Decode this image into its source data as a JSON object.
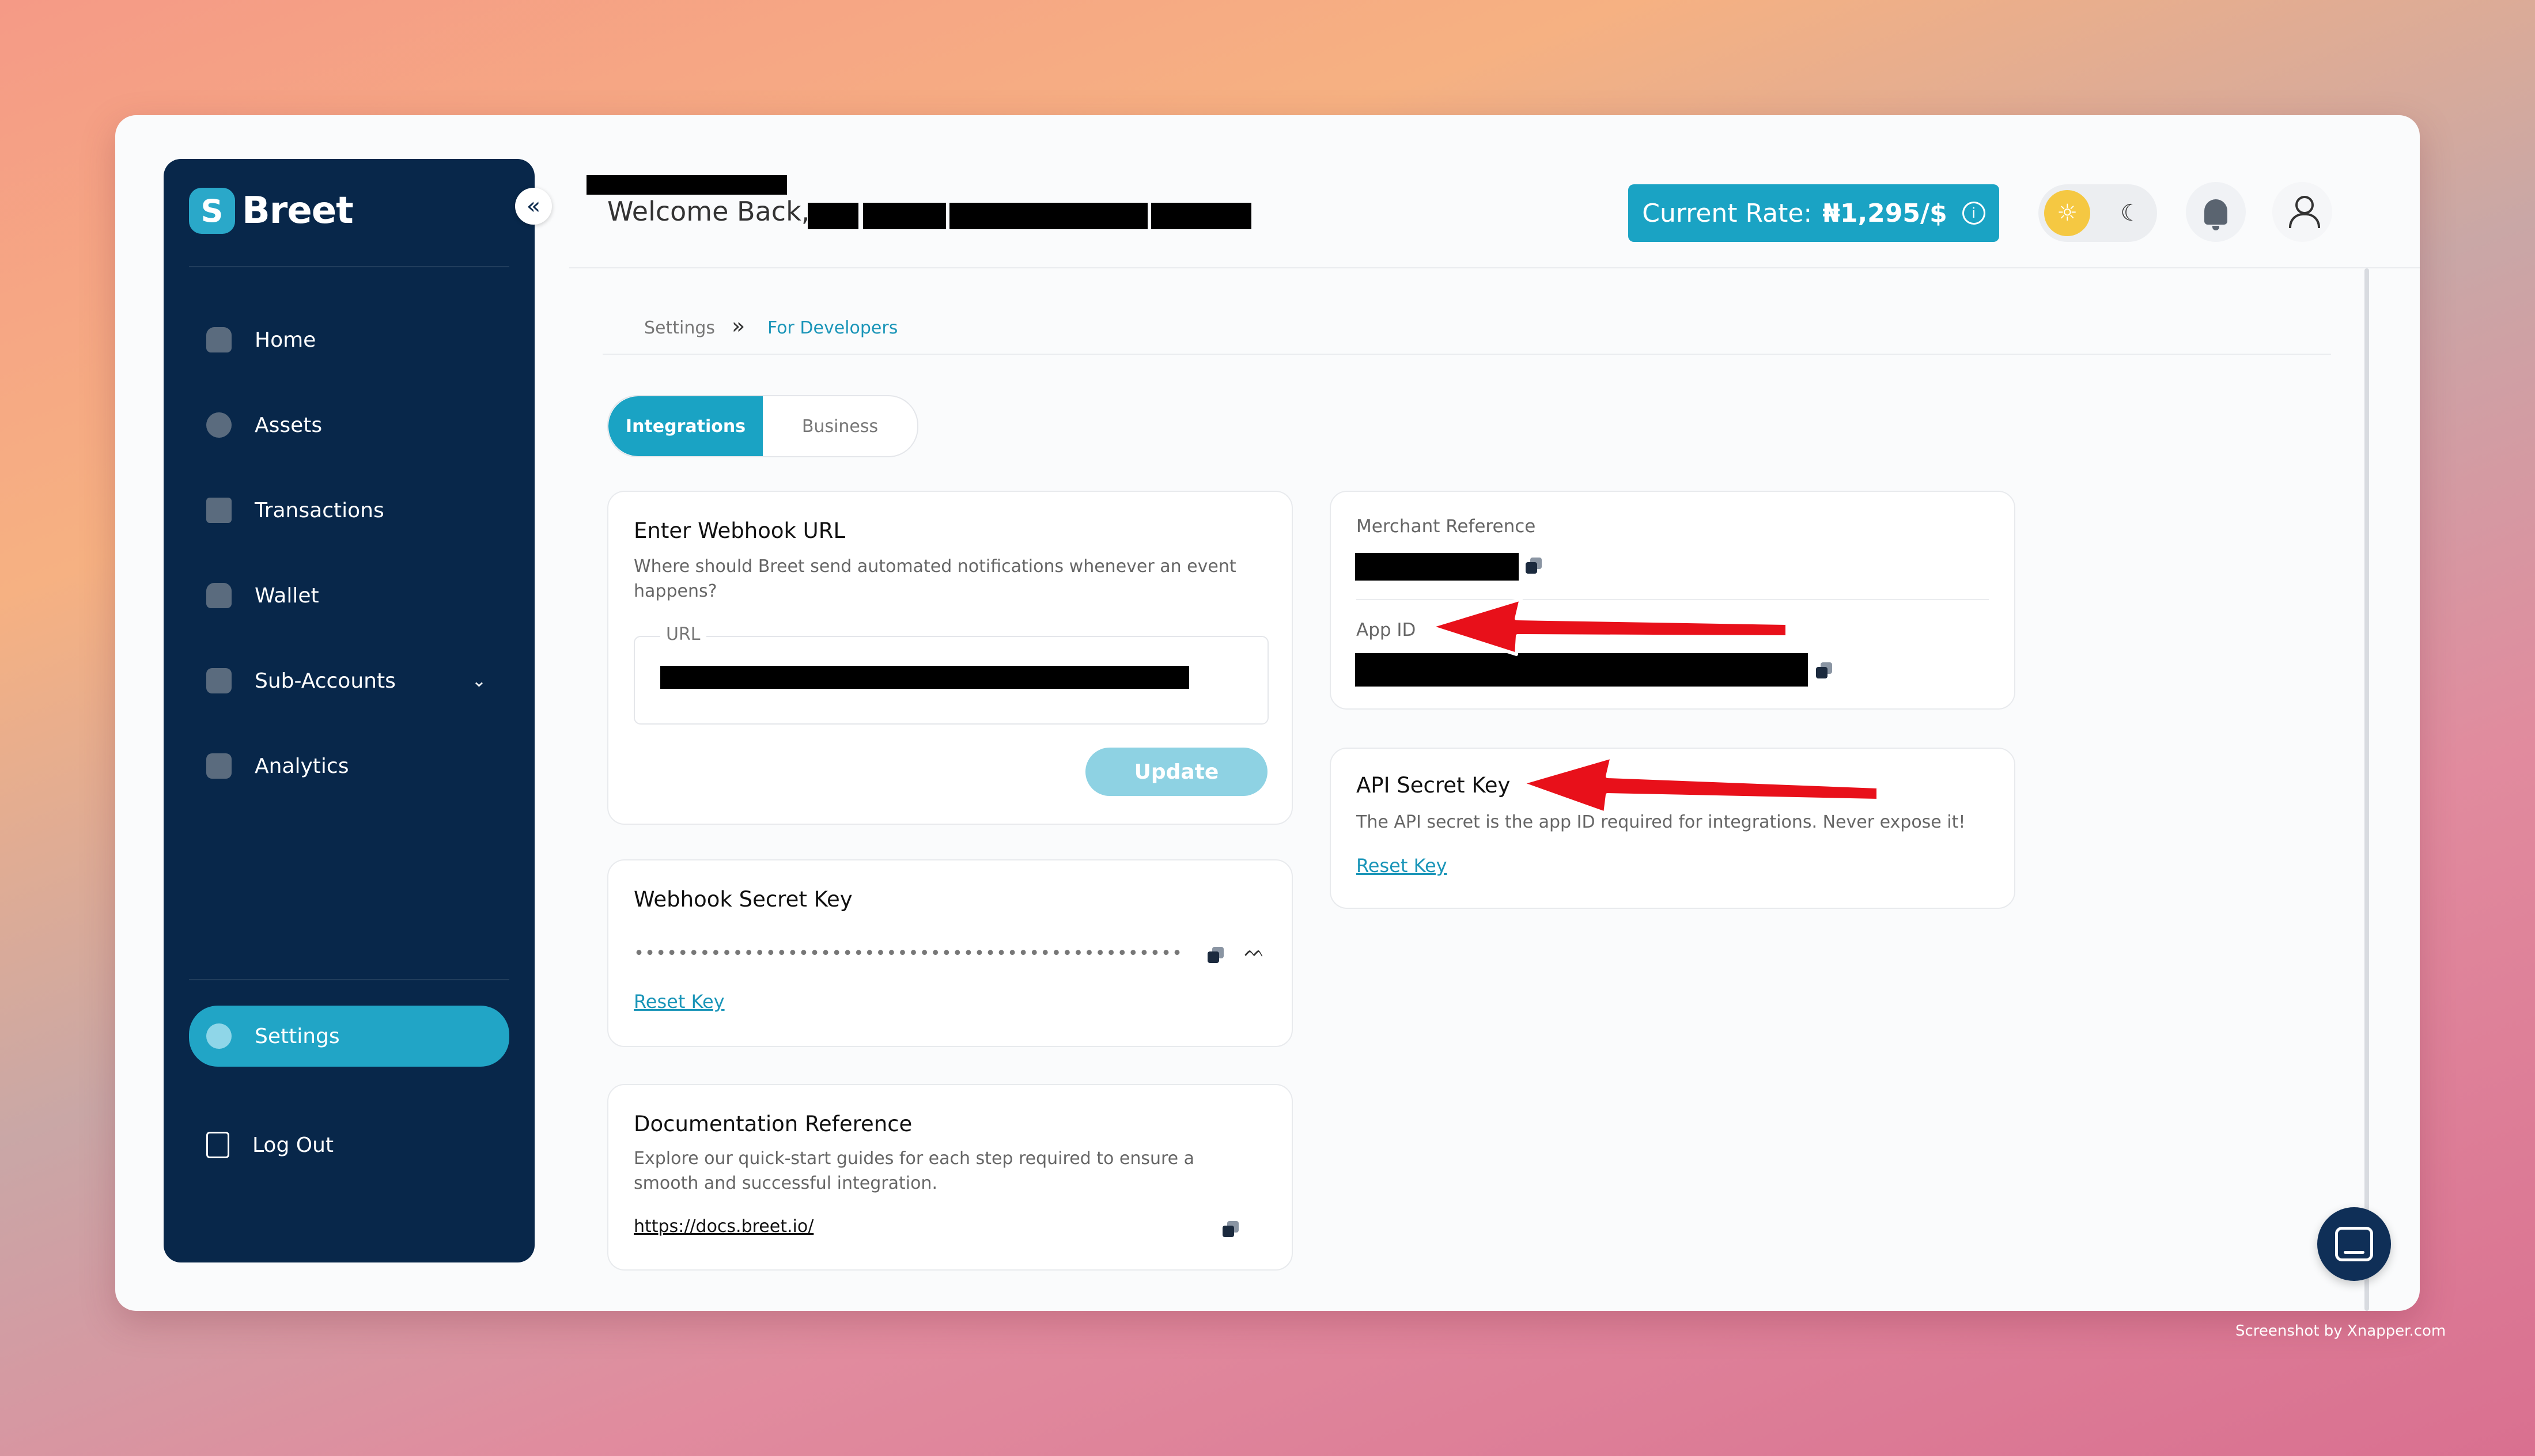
{
  "app": {
    "logo_mark": "S",
    "logo_text": "Breet",
    "collapse_icon": "«"
  },
  "sidebar": {
    "items": [
      {
        "label": "Home",
        "icon": "home-icon"
      },
      {
        "label": "Assets",
        "icon": "assets-icon"
      },
      {
        "label": "Transactions",
        "icon": "transactions-icon"
      },
      {
        "label": "Wallet",
        "icon": "wallet-icon"
      },
      {
        "label": "Sub-Accounts",
        "icon": "sub-accounts-icon",
        "chevron": "⌄"
      },
      {
        "label": "Analytics",
        "icon": "analytics-icon"
      }
    ],
    "settings_label": "Settings",
    "logout_label": "Log Out"
  },
  "header": {
    "welcome": "Welcome Back,",
    "rate_label": "Current Rate:",
    "rate_value": "₦1,295/$",
    "rate_info": "i",
    "sun_icon": "☼",
    "moon_icon": "☾"
  },
  "breadcrumb": {
    "parent": "Settings",
    "separator": "»",
    "current": "For Developers"
  },
  "tabs": {
    "active": "Integrations",
    "inactive": "Business"
  },
  "webhook_url": {
    "title": "Enter Webhook URL",
    "description": "Where should Breet send automated notifications whenever an event happens?",
    "field_label": "URL",
    "button": "Update"
  },
  "webhook_secret": {
    "title": "Webhook Secret Key",
    "masked": "••••••••••••••••••••••••••••••••••••••••••••••••••",
    "eye_icon": "ᨓ",
    "reset": "Reset Key"
  },
  "documentation": {
    "title": "Documentation Reference",
    "description": "Explore our quick-start guides for each step required to ensure a smooth and successful integration.",
    "link": "https://docs.breet.io/"
  },
  "merchant": {
    "merchant_label": "Merchant Reference",
    "app_id_label": "App ID"
  },
  "api_secret": {
    "title": "API Secret Key",
    "description": "The API secret is the app ID required for integrations. Never expose it!",
    "reset": "Reset Key"
  },
  "colors": {
    "primary": "#1aa3c4",
    "sidebar": "#08274a",
    "arrow": "#e8101a"
  },
  "watermark": "Screenshot by Xnapper.com"
}
